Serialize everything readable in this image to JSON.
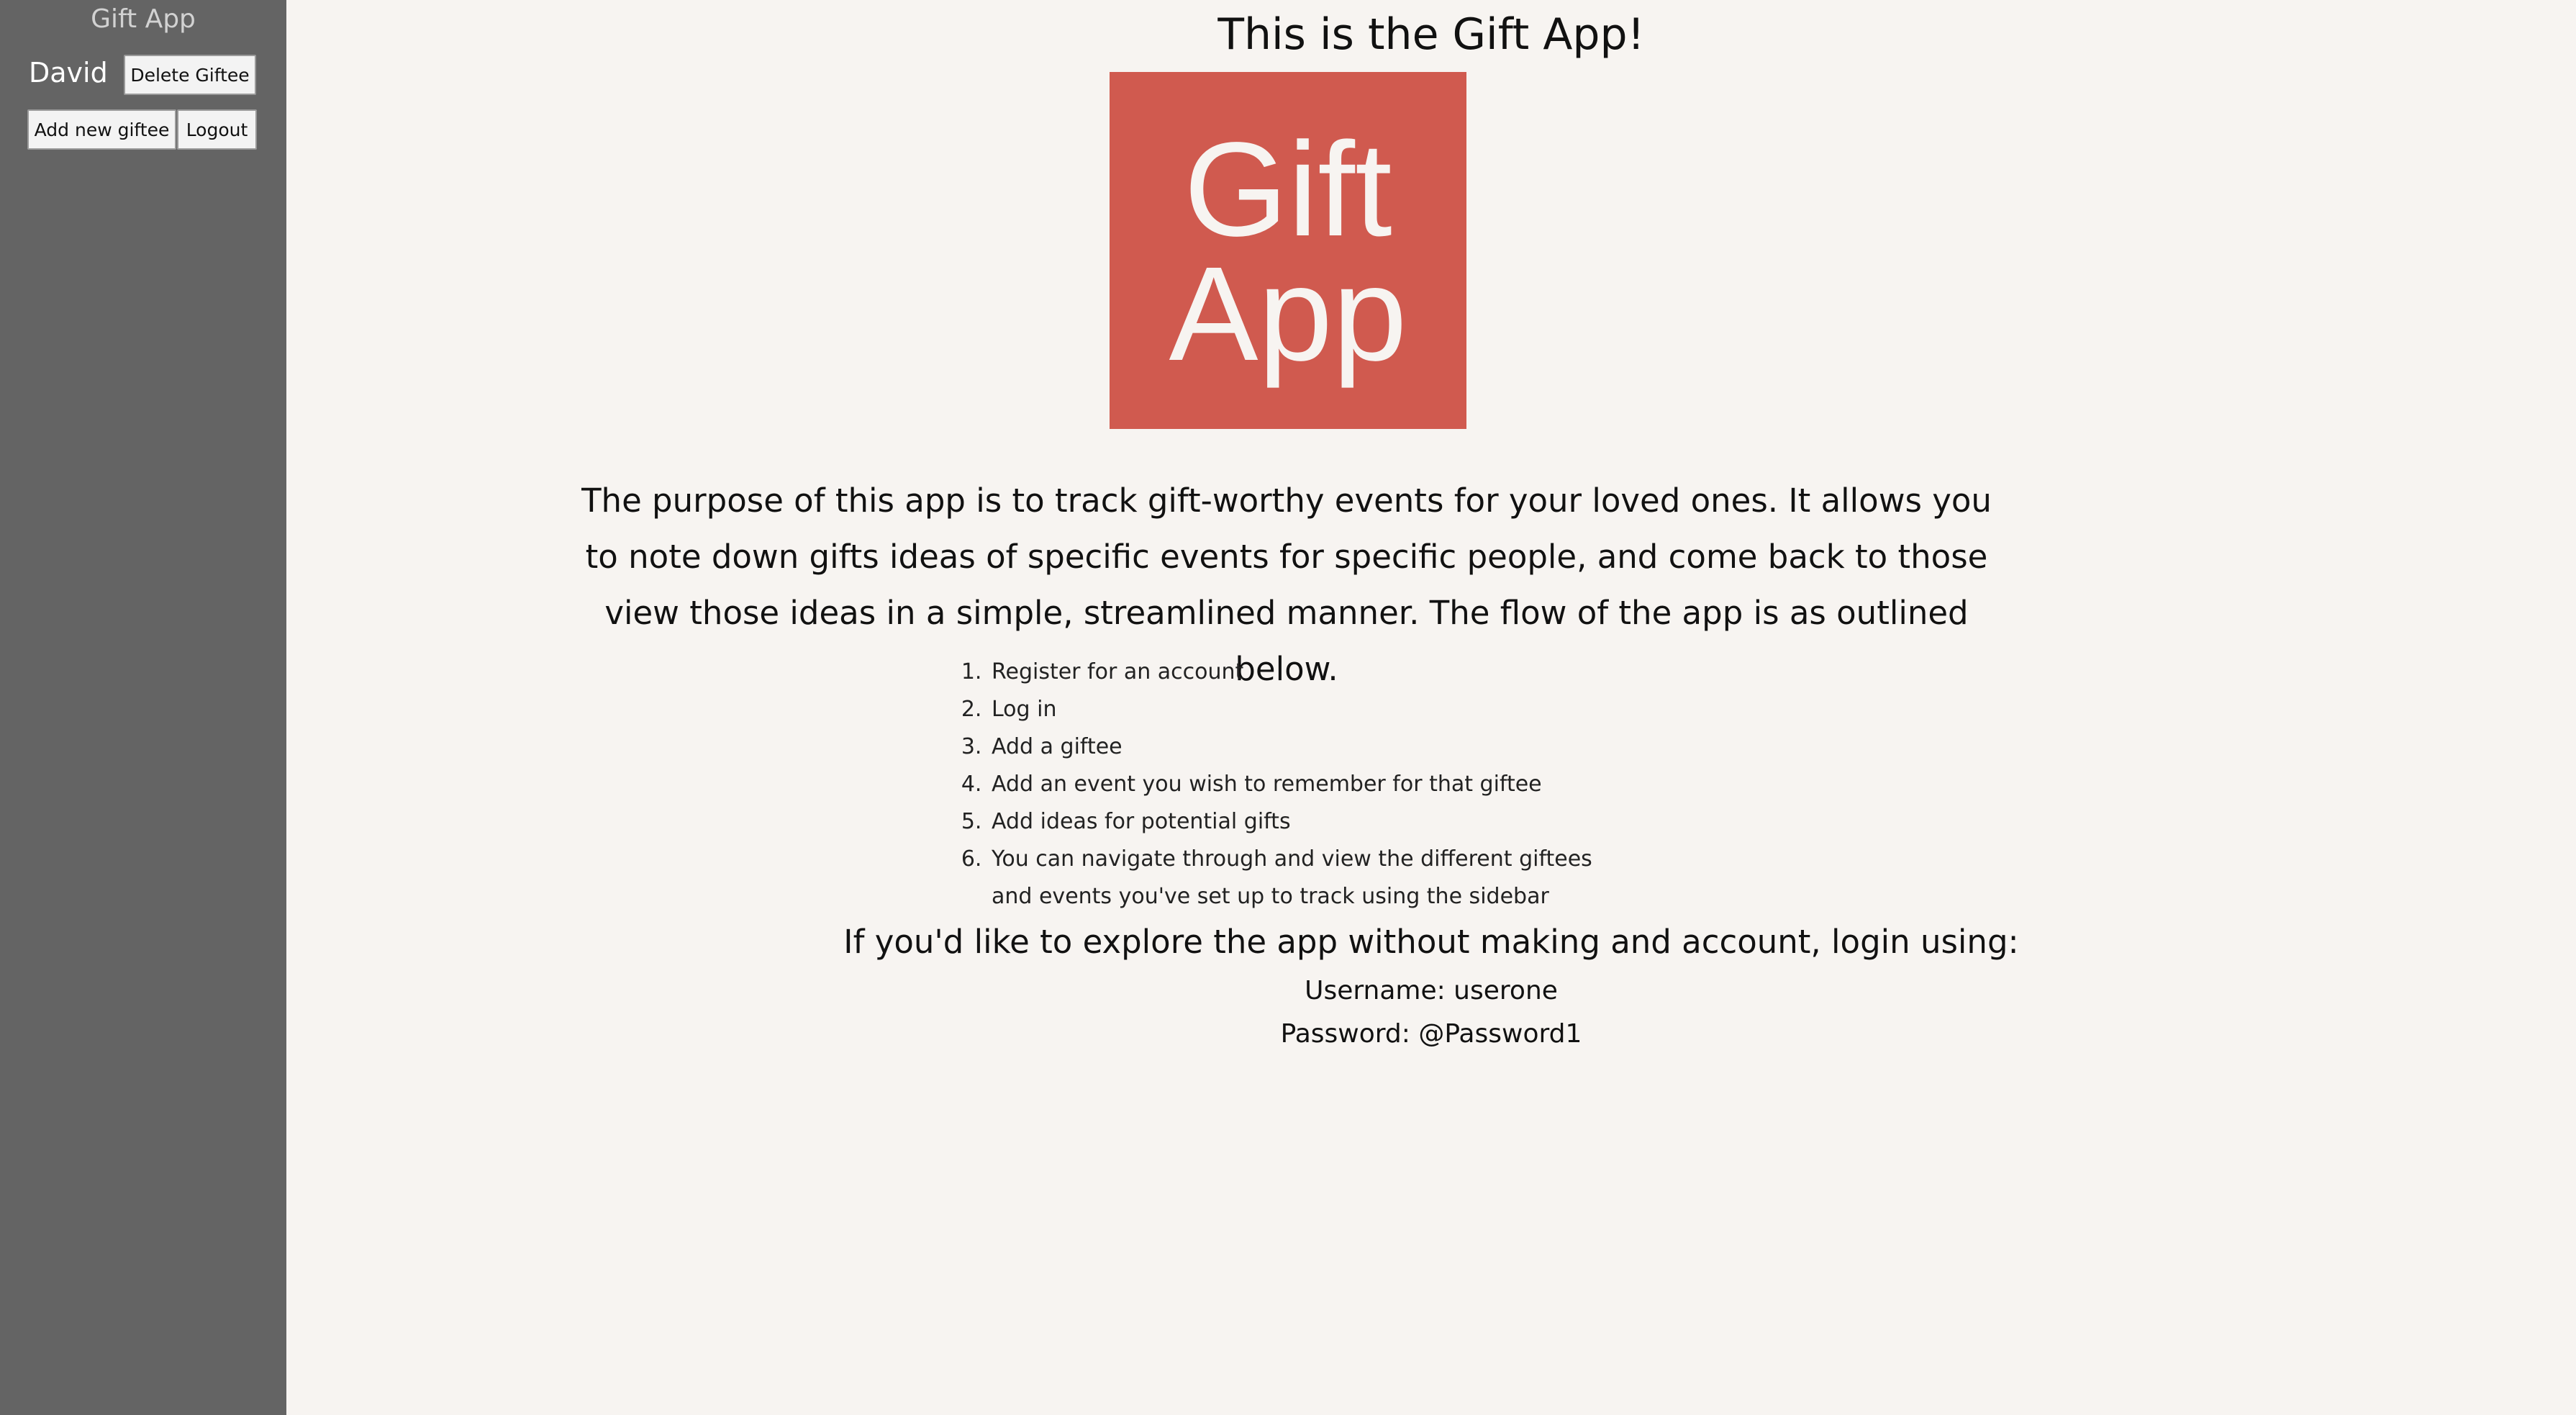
{
  "sidebar": {
    "title": "Gift App",
    "user_name": "David",
    "delete_label": "Delete Giftee",
    "add_label": "Add new giftee",
    "logout_label": "Logout"
  },
  "main": {
    "title": "This is the Gift App!",
    "logo": {
      "line1": "Gift",
      "line2": "App",
      "background": "#d05a4f",
      "text_color": "#f7f4f1"
    },
    "description": "The purpose of this app is to track gift-worthy events for your loved ones. It allows you to note down gifts ideas of specific events for specific people, and come back to those view those ideas in a simple, streamlined manner. The flow of the app is as outlined below.",
    "steps": [
      "Register for an account",
      "Log in",
      "Add a giftee",
      "Add an event you wish to remember for that giftee",
      "Add ideas for potential gifts",
      "You can navigate through and view the different giftees and events you've set up to track using the sidebar"
    ],
    "explore_text": "If you'd like to explore the app without making and account, login using:",
    "username_text": "Username: userone",
    "password_text": "Password: @Password1"
  },
  "colors": {
    "sidebar_bg": "#646464",
    "page_bg": "#f7f4f1",
    "accent": "#d05a4f"
  }
}
